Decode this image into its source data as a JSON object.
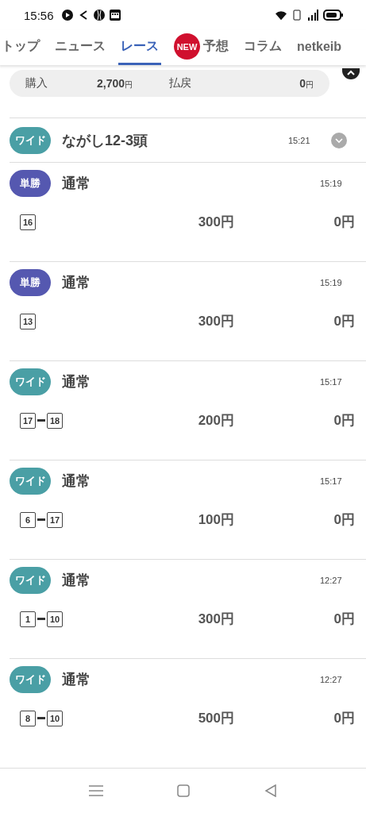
{
  "status_bar": {
    "time": "15:56"
  },
  "tabs": [
    {
      "label": "トップ",
      "selected": false
    },
    {
      "label": "ニュース",
      "selected": false
    },
    {
      "label": "レース",
      "selected": true
    },
    {
      "label": "予想",
      "selected": false,
      "badge": "NEW"
    },
    {
      "label": "コラム",
      "selected": false
    },
    {
      "label": "netkeib",
      "selected": false
    }
  ],
  "summary": {
    "purchase_label": "購入",
    "purchase_value": "2,700",
    "purchase_unit": "円",
    "payout_label": "払戻",
    "payout_value": "0",
    "payout_unit": "円"
  },
  "group": {
    "type": "ワイド",
    "color": "#4a9fa5",
    "title": "ながし12-3頭",
    "time": "15:21",
    "expanded": false
  },
  "bets": [
    {
      "type": "単勝",
      "color": "#5558b0",
      "method": "通常",
      "time": "15:19",
      "numbers": [
        "16"
      ],
      "amount": "300円",
      "payout": "0円"
    },
    {
      "type": "単勝",
      "color": "#5558b0",
      "method": "通常",
      "time": "15:19",
      "numbers": [
        "13"
      ],
      "amount": "300円",
      "payout": "0円"
    },
    {
      "type": "ワイド",
      "color": "#4a9fa5",
      "method": "通常",
      "time": "15:17",
      "numbers": [
        "17",
        "18"
      ],
      "amount": "200円",
      "payout": "0円"
    },
    {
      "type": "ワイド",
      "color": "#4a9fa5",
      "method": "通常",
      "time": "15:17",
      "numbers": [
        "6",
        "17"
      ],
      "amount": "100円",
      "payout": "0円"
    },
    {
      "type": "ワイド",
      "color": "#4a9fa5",
      "method": "通常",
      "time": "12:27",
      "numbers": [
        "1",
        "10"
      ],
      "amount": "300円",
      "payout": "0円"
    },
    {
      "type": "ワイド",
      "color": "#4a9fa5",
      "method": "通常",
      "time": "12:27",
      "numbers": [
        "8",
        "10"
      ],
      "amount": "500円",
      "payout": "0円"
    }
  ]
}
